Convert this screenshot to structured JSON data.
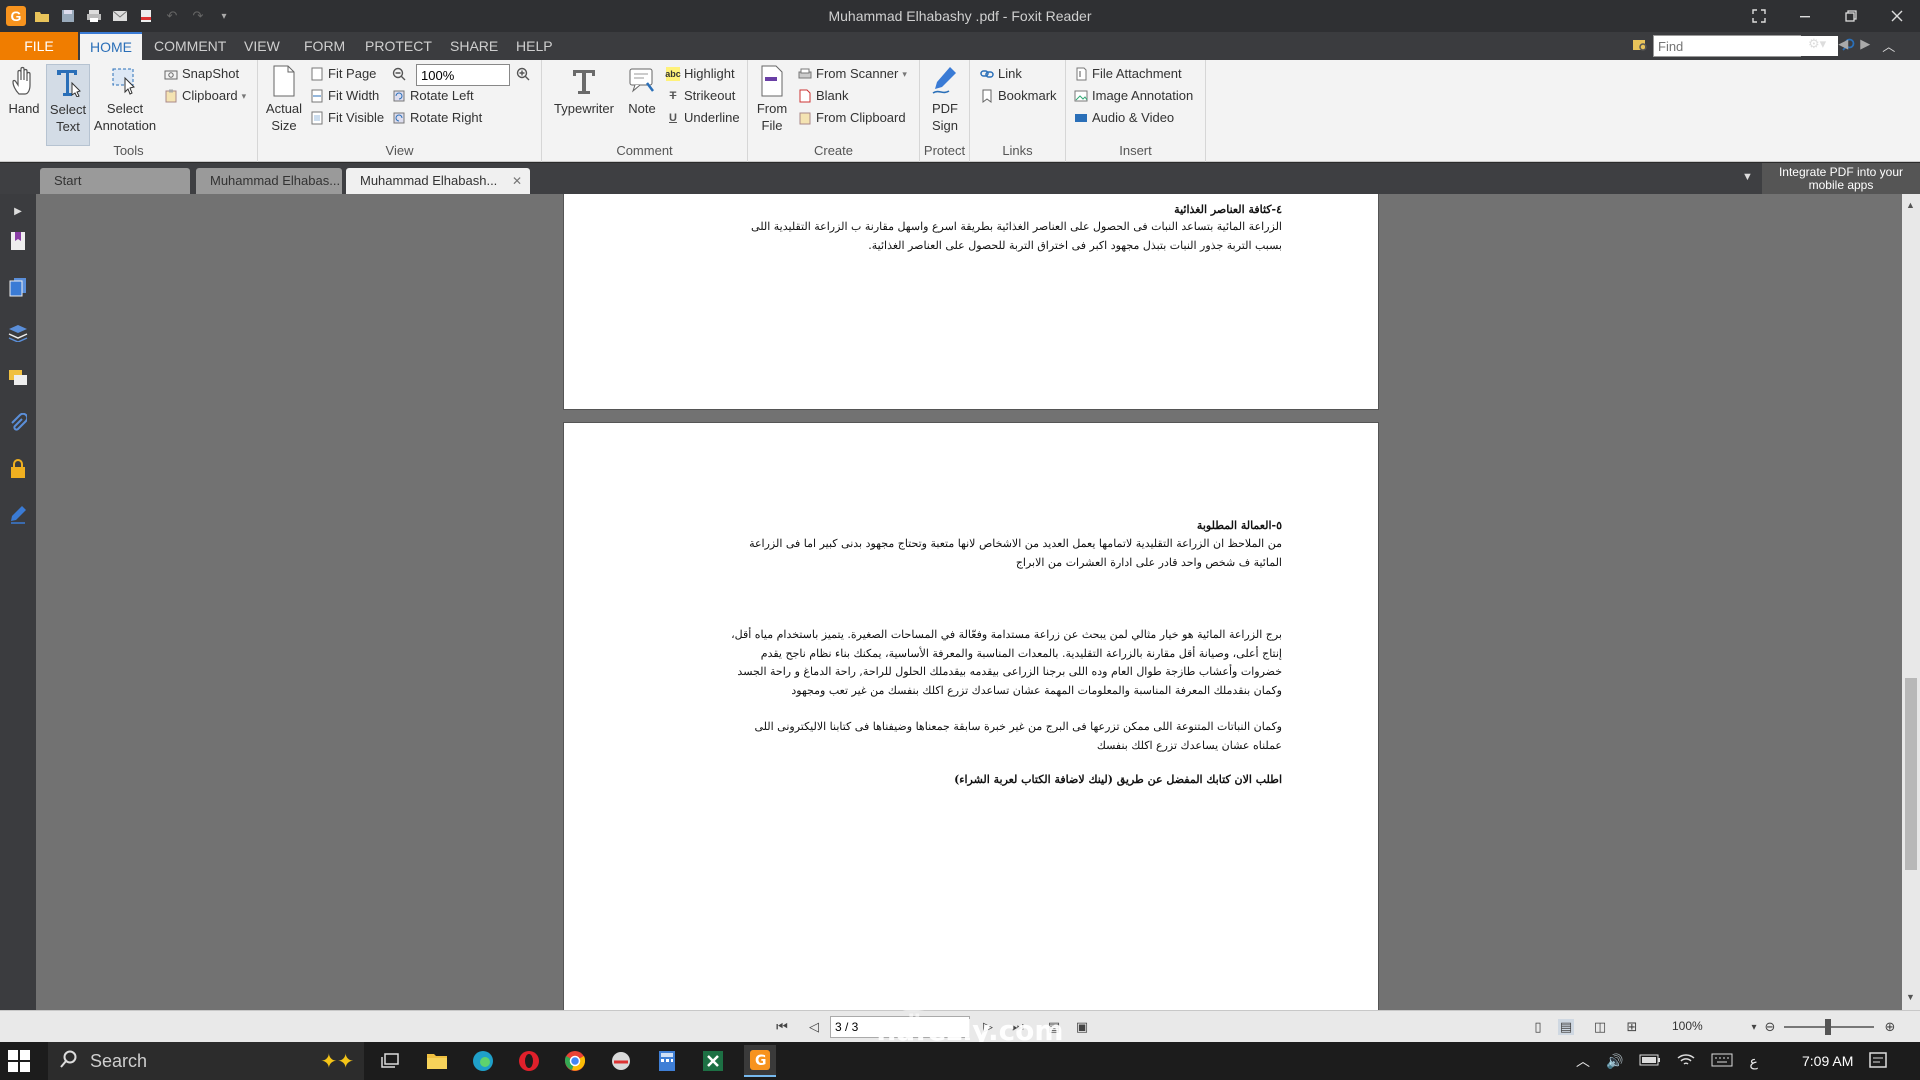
{
  "window": {
    "title": "Muhammad Elhabashy .pdf - Foxit Reader",
    "app_logo_text": "G"
  },
  "menu": {
    "tabs": [
      "FILE",
      "HOME",
      "COMMENT",
      "VIEW",
      "FORM",
      "PROTECT",
      "SHARE",
      "HELP"
    ],
    "active_tab": "HOME",
    "find_placeholder": "Find"
  },
  "ribbon": {
    "tools": {
      "label": "Tools",
      "hand": "Hand",
      "select_text_1": "Select",
      "select_text_2": "Text",
      "select_annotation_1": "Select",
      "select_annotation_2": "Annotation",
      "snapshot": "SnapShot",
      "clipboard": "Clipboard"
    },
    "view": {
      "label": "View",
      "actual_size_1": "Actual",
      "actual_size_2": "Size",
      "fit_page": "Fit Page",
      "fit_width": "Fit Width",
      "fit_visible": "Fit Visible",
      "zoom_value": "100%",
      "rotate_left": "Rotate Left",
      "rotate_right": "Rotate Right"
    },
    "comment": {
      "label": "Comment",
      "typewriter": "Typewriter",
      "note": "Note",
      "highlight": "Highlight",
      "strikeout": "Strikeout",
      "underline": "Underline"
    },
    "create": {
      "label": "Create",
      "from_file_1": "From",
      "from_file_2": "File",
      "from_scanner": "From Scanner",
      "blank": "Blank",
      "from_clipboard": "From Clipboard"
    },
    "protect": {
      "label": "Protect",
      "pdf_sign_1": "PDF",
      "pdf_sign_2": "Sign"
    },
    "links": {
      "label": "Links",
      "link": "Link",
      "bookmark": "Bookmark"
    },
    "insert": {
      "label": "Insert",
      "file_attachment": "File Attachment",
      "image_annotation": "Image Annotation",
      "audio_video": "Audio & Video"
    }
  },
  "doc_tabs": {
    "start": "Start",
    "tab1": "Muhammad Elhabas...",
    "tab2": "Muhammad Elhabash...",
    "integrate": "Integrate PDF into your mobile apps"
  },
  "document": {
    "page2": {
      "heading": "٤-كثافة العناصر الغذائية",
      "body": "الزراعة المائية بتساعد النبات فى الحصول على العناصر الغذائية بطريقة اسرع واسهل مقارنة ب الزراعة التقليدية اللى\nبسبب التربة جذور النبات بتبذل مجهود اكبر فى اختراق التربة للحصول على العناصر الغذائية."
    },
    "page3": {
      "heading": "٥-العمالة المطلوبة",
      "body1": "من الملاحظ ان الزراعة التقليدية لاتمامها يعمل العديد من الاشخاص لانها متعبة وتحتاج مجهود بدنى كبير اما فى الزراعة\nالمائية ف شخص واحد قادر على ادارة العشرات من الابراج",
      "body2": "برج الزراعة المائية هو خيار مثالي لمن يبحث عن زراعة مستدامة وفعّالة في المساحات الصغيرة. يتميز باستخدام مياه أقل،\nإنتاج أعلى، وصيانة أقل مقارنة بالزراعة التقليدية. بالمعدات المناسبة والمعرفة الأساسية، يمكنك بناء نظام ناجح يقدم\nخضروات وأعشاب طازجة طوال العام وده اللى برجنا الزراعى بيقدمه بيقدملك الحلول للراحة, راحة الدماغ و راحة الجسد\nوكمان بنقدملك المعرفة المناسبة والمعلومات المهمة عشان تساعدك تزرع اكلك بنفسك من غير تعب ومجهود",
      "body3": "وكمان النباتات المتنوعة اللى ممكن تزرعها فى البرج من غير خبرة سابقة جمعناها وضيفناها فى كتابنا الاليكترونى اللى\nعملناه عشان يساعدك تزرع اكلك بنفسك",
      "cta": "اطلب الان كتابك المفضل عن طريق (لينك لاضافة الكتاب لعربة الشراء)"
    }
  },
  "status": {
    "page_indicator": "3 / 3",
    "zoom": "100%"
  },
  "watermark": {
    "arabic": "نفذلي",
    "site": "nafezly.com"
  },
  "taskbar": {
    "search_label": "Search",
    "time": "7:09 AM",
    "lang": "ع"
  }
}
